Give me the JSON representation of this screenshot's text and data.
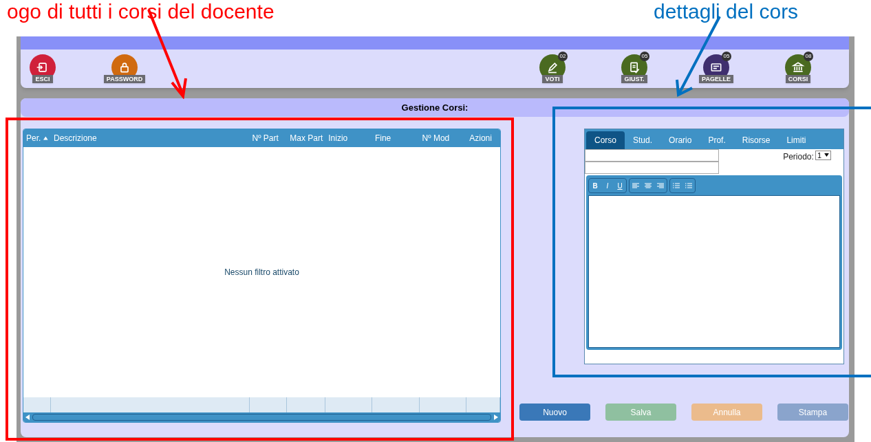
{
  "annotations": [
    {
      "text": "ogo di tutti i corsi del docente",
      "color": "#ff0000"
    },
    {
      "text": "dettagli del cors",
      "color": "#0070c0"
    }
  ],
  "toolbar": {
    "left": [
      {
        "label": "ESCI",
        "color": "#d0203a"
      },
      {
        "label": "PASSWORD",
        "color": "#d06a10"
      }
    ],
    "right": [
      {
        "label": "VOTI",
        "count": "02",
        "color": "#4a6a20"
      },
      {
        "label": "GIUST.",
        "count": "05",
        "color": "#4a6a20"
      },
      {
        "label": "PAGELLE",
        "count": "05",
        "color": "#3f2f6e"
      },
      {
        "label": "CORSI",
        "count": "08",
        "color": "#4a6a20"
      }
    ]
  },
  "panel_title": "Gestione Corsi:",
  "grid": {
    "columns": [
      {
        "label": "Per.",
        "sorted": true
      },
      {
        "label": "Descrizione",
        "sorted": false
      },
      {
        "label": "Nº Part",
        "sorted": false
      },
      {
        "label": "Max Part",
        "sorted": false
      },
      {
        "label": "Inizio",
        "sorted": false
      },
      {
        "label": "Fine",
        "sorted": false
      },
      {
        "label": "Nº Mod",
        "sorted": false
      },
      {
        "label": "Azioni",
        "sorted": false
      }
    ],
    "empty_message": "Nessun filtro attivato"
  },
  "detail": {
    "tabs": [
      {
        "label": "Corso",
        "selected": true
      },
      {
        "label": "Stud.",
        "selected": false
      },
      {
        "label": "Orario",
        "selected": false
      },
      {
        "label": "Prof.",
        "selected": false
      },
      {
        "label": "Risorse",
        "selected": false
      },
      {
        "label": "Limiti",
        "selected": false
      }
    ],
    "period_label": "Periodo:",
    "period_value": "1",
    "format_tools": [
      "B",
      "I",
      "U"
    ]
  },
  "buttons": [
    {
      "label": "Nuovo",
      "color": "#3a78b8"
    },
    {
      "label": "Salva",
      "color": "#8fc0a0"
    },
    {
      "label": "Annulla",
      "color": "#ebbb8c"
    },
    {
      "label": "Stampa",
      "color": "#8aa4cc"
    }
  ]
}
